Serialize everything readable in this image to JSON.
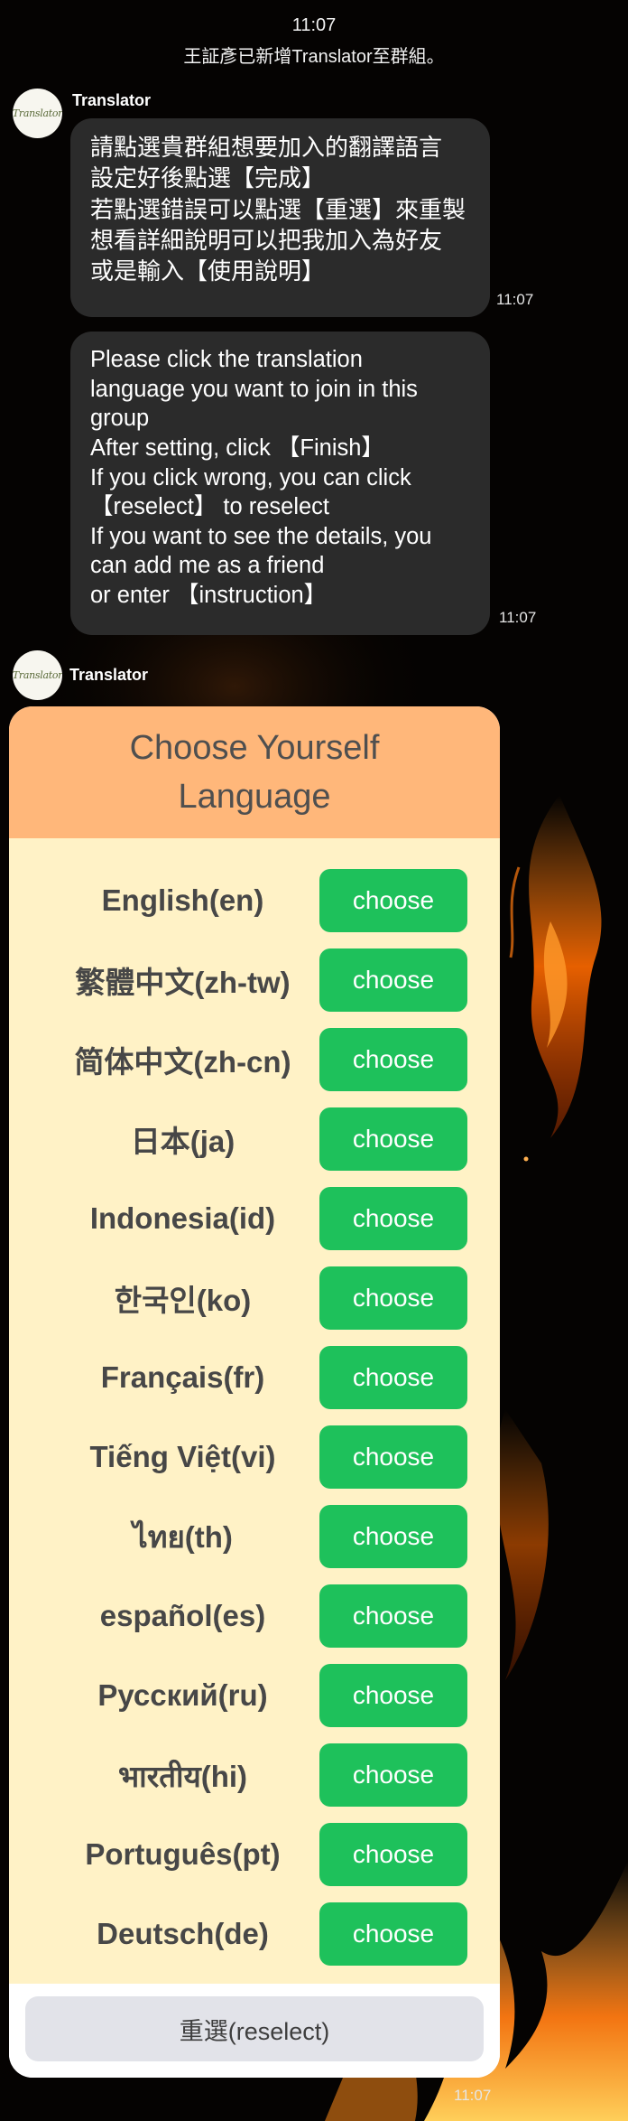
{
  "header": {
    "time": "11:07",
    "system_message": "王証彥已新增Translator至群組。"
  },
  "messages": [
    {
      "sender": "Translator",
      "avatar_text": "Translator",
      "bubbles": [
        {
          "lines": [
            "請點選貴群組想要加入的翻譯語言",
            "設定好後點選【完成】",
            "若點選錯誤可以點選【重選】來重製",
            "想看詳細說明可以把我加入為好友",
            "或是輸入【使用說明】"
          ],
          "time": "11:07"
        },
        {
          "lines": [
            "Please click the translation",
            "language you want to join in this",
            "group",
            "After setting, click 【Finish】",
            "If you click wrong, you can click",
            "【reselect】 to reselect",
            "If you want to see the details, you",
            "can add me as a friend",
            "or enter 【instruction】"
          ],
          "time": "11:07"
        }
      ]
    },
    {
      "sender": "Translator",
      "avatar_text": "Translator",
      "card": {
        "title_lines": [
          "Choose Yourself",
          "Language"
        ],
        "languages": [
          {
            "label": "English(en)",
            "button": "choose"
          },
          {
            "label": "繁體中文(zh-tw)",
            "button": "choose"
          },
          {
            "label": "简体中文(zh-cn)",
            "button": "choose"
          },
          {
            "label": "日本(ja)",
            "button": "choose"
          },
          {
            "label": "Indonesia(id)",
            "button": "choose"
          },
          {
            "label": "한국인(ko)",
            "button": "choose"
          },
          {
            "label": "Français(fr)",
            "button": "choose"
          },
          {
            "label": "Tiếng Việt(vi)",
            "button": "choose"
          },
          {
            "label": "ไทย(th)",
            "button": "choose"
          },
          {
            "label": "español(es)",
            "button": "choose"
          },
          {
            "label": "Русский(ru)",
            "button": "choose"
          },
          {
            "label": "भारतीय(hi)",
            "button": "choose"
          },
          {
            "label": "Português(pt)",
            "button": "choose"
          },
          {
            "label": "Deutsch(de)",
            "button": "choose"
          }
        ],
        "reselect_label": "重選(reselect)"
      },
      "time": "11:07"
    }
  ],
  "colors": {
    "background": "#050302",
    "bubble": "#2b2b2b",
    "card_header": "#ffb77a",
    "card_body": "#fff2c6",
    "choose_button": "#1ec15b",
    "reselect_button": "#e2e3e9"
  }
}
